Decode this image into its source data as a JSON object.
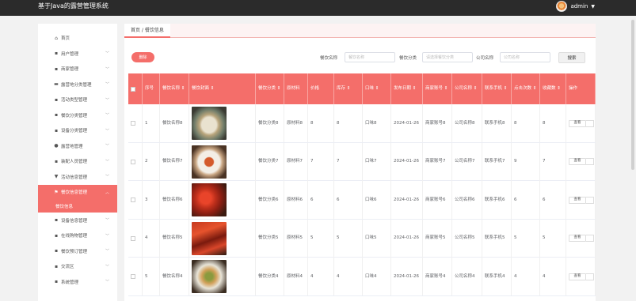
{
  "app": {
    "title": "基于Java的露营管理系统",
    "user": "admin"
  },
  "sidebar": {
    "home": "首页",
    "items": [
      {
        "label": "用户管理",
        "icon": "grid-icon"
      },
      {
        "label": "商家管理",
        "icon": "shop-icon"
      },
      {
        "label": "露营地分类管理",
        "icon": "monitor-icon"
      },
      {
        "label": "活动类型管理",
        "icon": "grid-icon"
      },
      {
        "label": "餐饮分类管理",
        "icon": "chat-icon"
      },
      {
        "label": "设备分类管理",
        "icon": "grid-icon"
      },
      {
        "label": "露营地管理",
        "icon": "user-icon"
      },
      {
        "label": "装配人员管理",
        "icon": "grid-icon"
      },
      {
        "label": "活动信息管理",
        "icon": "filter-icon"
      },
      {
        "label": "餐饮信息管理",
        "icon": "flag-icon",
        "active": true
      },
      {
        "label": "设备信息管理",
        "icon": "grid-icon"
      },
      {
        "label": "在线购物管理",
        "icon": "grid-icon"
      },
      {
        "label": "餐饮预订管理",
        "icon": "grid-icon"
      },
      {
        "label": "交流区",
        "icon": "grid-icon"
      },
      {
        "label": "系统管理",
        "icon": "grid-icon"
      }
    ],
    "sub_active": "餐饮信息"
  },
  "breadcrumb": "首页 / 餐饮信息",
  "toolbar": {
    "delete": "删除",
    "name_label": "餐饮名称",
    "name_placeholder": "餐饮名称",
    "cat_label": "餐饮分类",
    "cat_placeholder": "请选择餐饮分类",
    "company_label": "公司名称",
    "company_placeholder": "公司名称",
    "search": "搜索"
  },
  "table": {
    "headers": [
      "序号",
      "餐饮名称 ⇕",
      "餐饮封面 ⇕",
      "餐饮分类 ⇕",
      "原材料",
      "价格",
      "库存 ⇕",
      "口味 ⇕",
      "发布日期 ⇕",
      "商家账号 ⇕",
      "公司名称 ⇕",
      "联系手机 ⇕",
      "点击次数 ⇕",
      "收藏数 ⇕",
      "操作"
    ],
    "view_label": "查看",
    "rows": [
      {
        "no": "1",
        "name": "餐饮名称8",
        "cat": "餐饮分类8",
        "raw": "原材料8",
        "price": "8",
        "stock": "8",
        "taste": "口味8",
        "date": "2024-01-26",
        "acct": "商家账号8",
        "company": "公司名称8",
        "phone": "联系手机8",
        "clicks": "8",
        "favs": "8"
      },
      {
        "no": "2",
        "name": "餐饮名称7",
        "cat": "餐饮分类7",
        "raw": "原材料7",
        "price": "7",
        "stock": "7",
        "taste": "口味7",
        "date": "2024-01-26",
        "acct": "商家账号7",
        "company": "公司名称7",
        "phone": "联系手机7",
        "clicks": "9",
        "favs": "7"
      },
      {
        "no": "3",
        "name": "餐饮名称6",
        "cat": "餐饮分类6",
        "raw": "原材料6",
        "price": "6",
        "stock": "6",
        "taste": "口味6",
        "date": "2024-01-26",
        "acct": "商家账号6",
        "company": "公司名称6",
        "phone": "联系手机6",
        "clicks": "6",
        "favs": "6"
      },
      {
        "no": "4",
        "name": "餐饮名称5",
        "cat": "餐饮分类5",
        "raw": "原材料5",
        "price": "5",
        "stock": "5",
        "taste": "口味5",
        "date": "2024-01-26",
        "acct": "商家账号5",
        "company": "公司名称5",
        "phone": "联系手机5",
        "clicks": "5",
        "favs": "5"
      },
      {
        "no": "5",
        "name": "餐饮名称4",
        "cat": "餐饮分类4",
        "raw": "原材料4",
        "price": "4",
        "stock": "4",
        "taste": "口味4",
        "date": "2024-01-26",
        "acct": "商家账号4",
        "company": "公司名称4",
        "phone": "联系手机4",
        "clicks": "4",
        "favs": "4"
      }
    ]
  },
  "colors": {
    "accent": "#f46e6a",
    "topbar": "#2b2b2b"
  }
}
